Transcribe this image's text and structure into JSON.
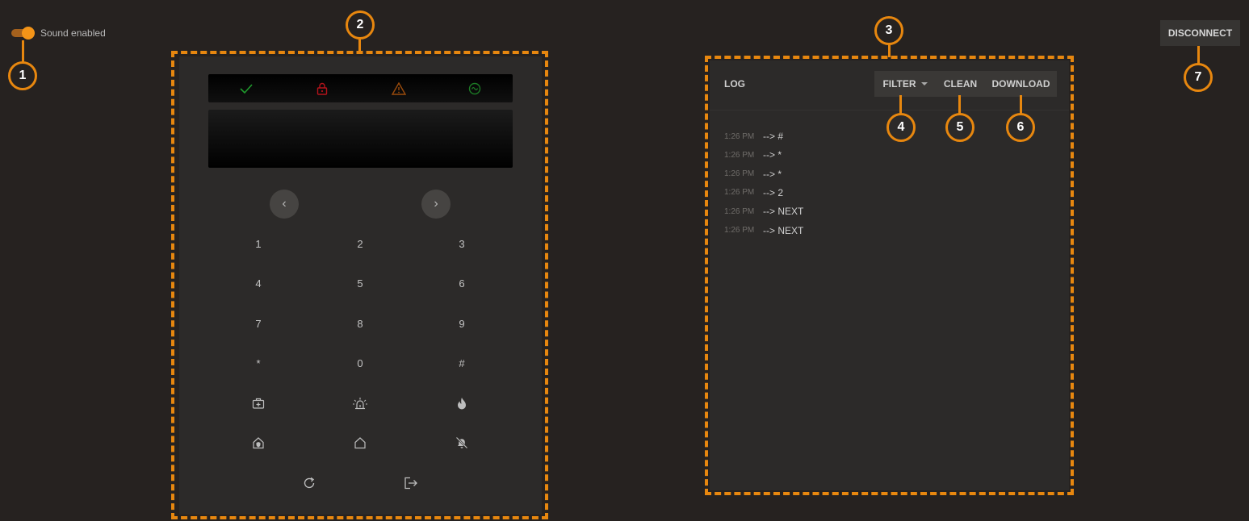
{
  "sound_toggle": {
    "label": "Sound enabled",
    "on": true
  },
  "keypad": {
    "indicators": [
      {
        "icon": "check-icon",
        "color": "#1f9a2d"
      },
      {
        "icon": "lock-icon",
        "color": "#b3131b"
      },
      {
        "icon": "warning-icon",
        "color": "#9a4b0c"
      },
      {
        "icon": "power-icon",
        "color": "#1c7a25"
      }
    ],
    "nav": {
      "prev": "‹",
      "next": "›"
    },
    "keys": {
      "k1": "1",
      "k2": "2",
      "k3": "3",
      "k4": "4",
      "k5": "5",
      "k6": "6",
      "k7": "7",
      "k8": "8",
      "k9": "9",
      "kstar": "*",
      "k0": "0",
      "khash": "#"
    },
    "icon_keys": [
      "medical-icon",
      "alarm-siren-icon",
      "fire-icon",
      "home-shield-icon",
      "home-icon",
      "bell-off-icon",
      "refresh-icon",
      "exit-icon"
    ]
  },
  "log": {
    "title": "LOG",
    "filter_label": "FILTER",
    "clean_label": "CLEAN",
    "download_label": "DOWNLOAD",
    "entries": [
      {
        "time": "1:26 PM",
        "msg": "--> #"
      },
      {
        "time": "1:26 PM",
        "msg": "--> *"
      },
      {
        "time": "1:26 PM",
        "msg": "--> *"
      },
      {
        "time": "1:26 PM",
        "msg": "--> 2"
      },
      {
        "time": "1:26 PM",
        "msg": "--> NEXT"
      },
      {
        "time": "1:26 PM",
        "msg": "--> NEXT"
      }
    ]
  },
  "disconnect_label": "DISCONNECT",
  "callouts": {
    "c1": "1",
    "c2": "2",
    "c3": "3",
    "c4": "4",
    "c5": "5",
    "c6": "6",
    "c7": "7"
  },
  "accent_color": "#e7870f"
}
